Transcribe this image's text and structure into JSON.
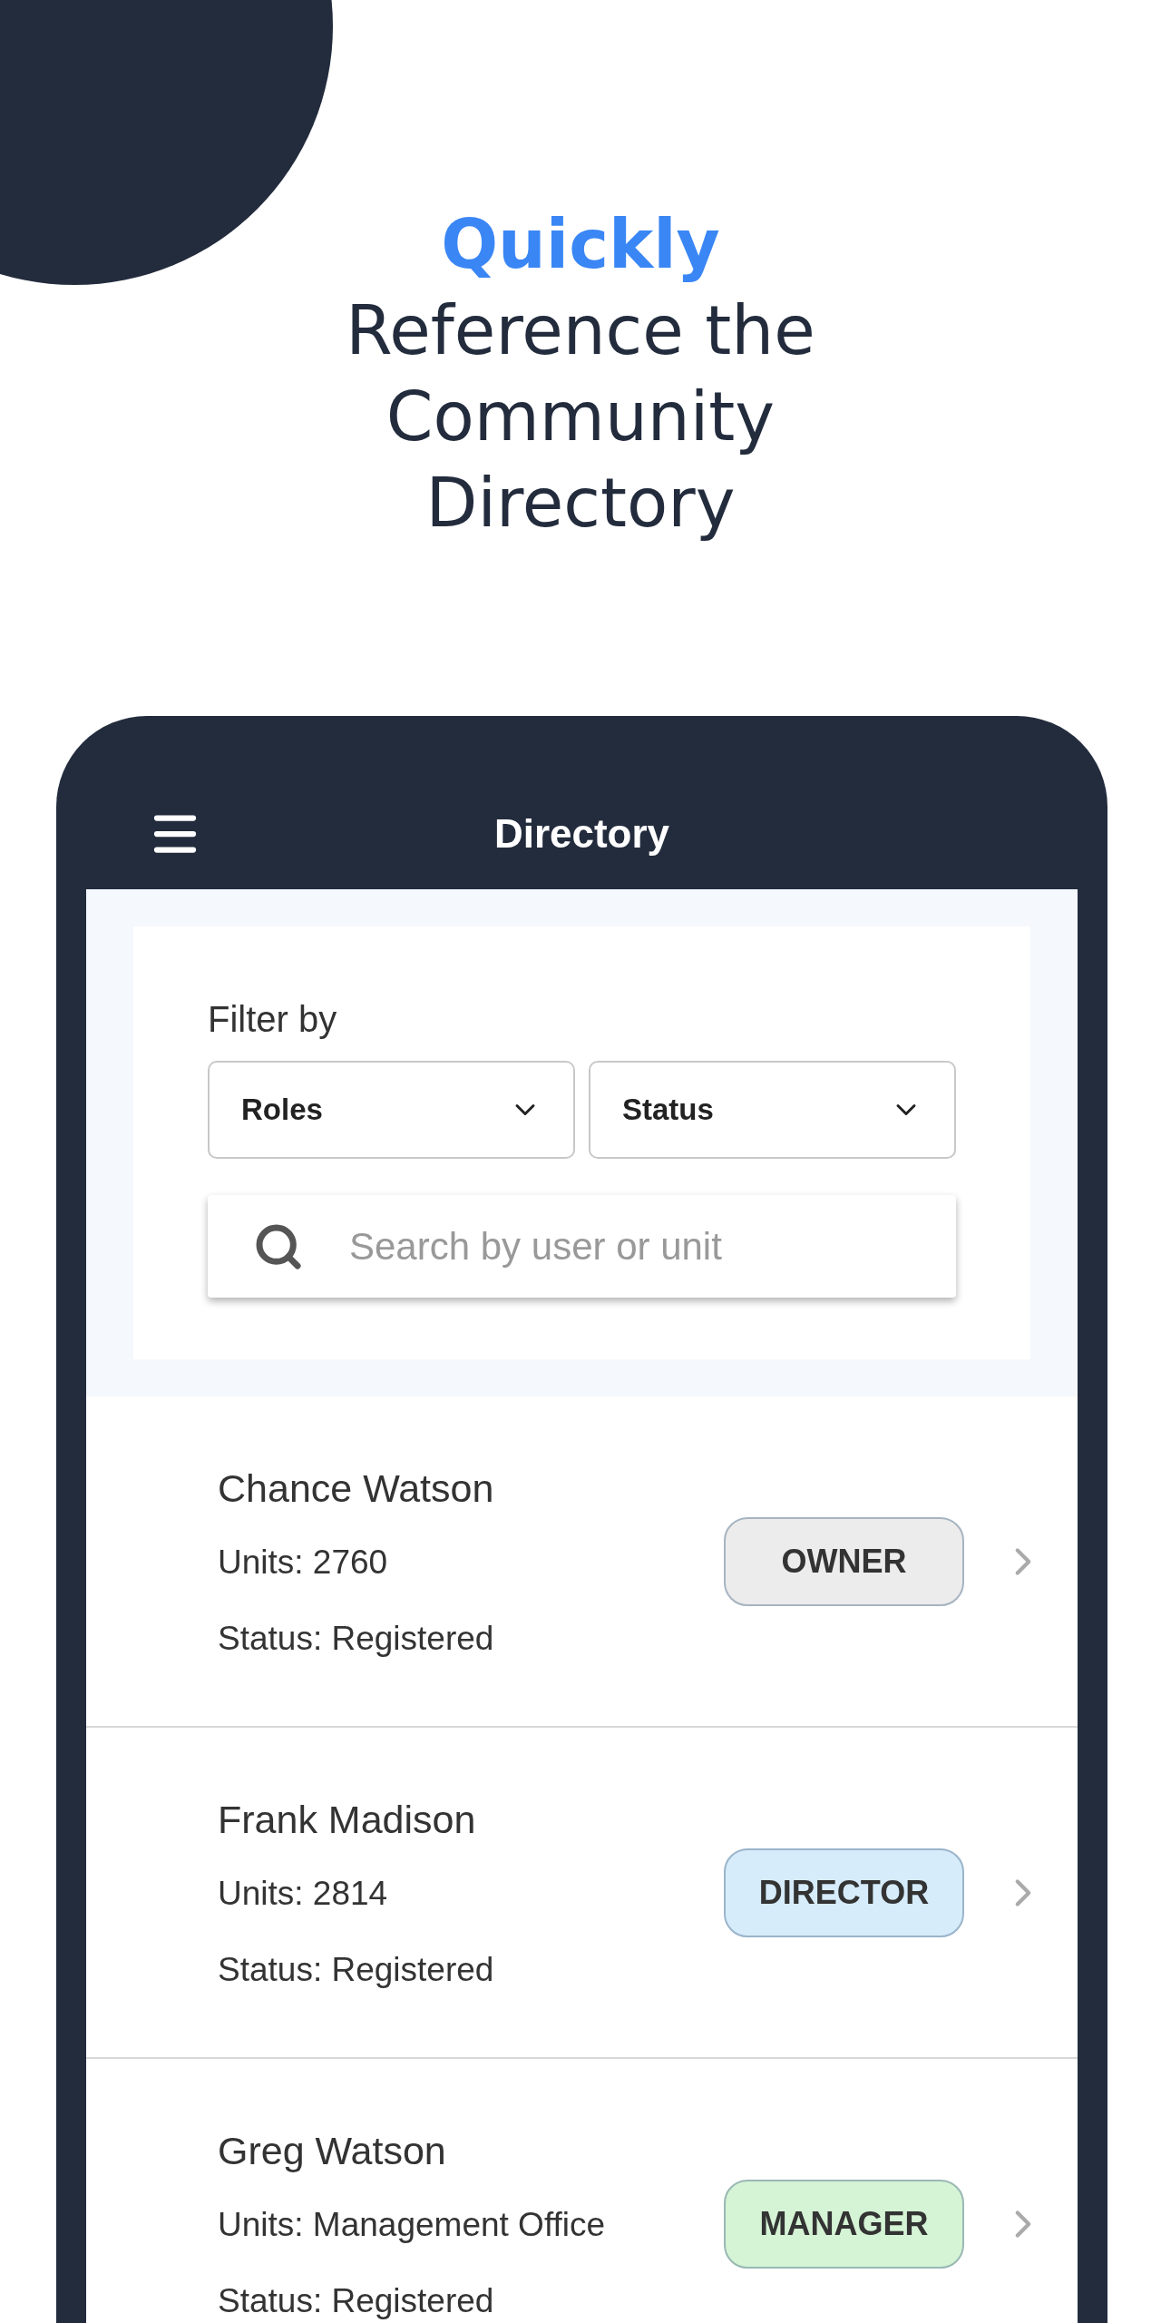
{
  "heading": {
    "highlight": "Quickly",
    "lines": [
      "Reference the",
      "Community",
      "Directory"
    ]
  },
  "app_bar": {
    "title": "Directory"
  },
  "filter": {
    "label": "Filter by",
    "dropdowns": [
      "Roles",
      "Status"
    ],
    "search": {
      "placeholder": "Search by user or unit"
    }
  },
  "members": [
    {
      "name": "Chance Watson",
      "units": "Units: 2760",
      "status": "Status: Registered",
      "role": "OWNER",
      "color": "#ececec"
    },
    {
      "name": "Frank Madison",
      "units": "Units: 2814",
      "status": "Status: Registered",
      "role": "DIRECTOR",
      "color": "#d6ecfb"
    },
    {
      "name": "Greg Watson",
      "units": "Units: Management Office",
      "status": "Status: Registered",
      "role": "MANAGER",
      "color": "#d5f3d5"
    }
  ]
}
